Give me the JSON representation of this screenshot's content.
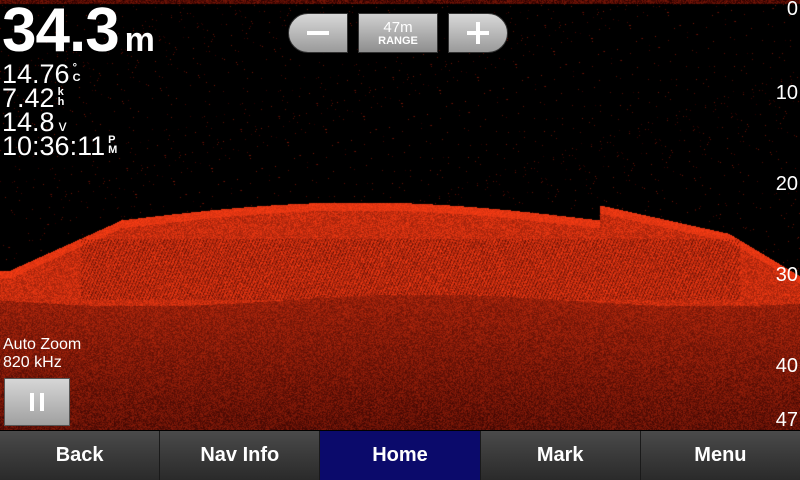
{
  "readouts": {
    "depth": "34.3",
    "depth_unit": "m",
    "temperature": "14.76",
    "temperature_unit_top": "°",
    "temperature_unit_bottom": "C",
    "speed": "7.42",
    "speed_unit_top": "k",
    "speed_unit_bottom": "h",
    "voltage": "14.8",
    "voltage_unit": "v",
    "time": "10:36:11",
    "time_unit_top": "P",
    "time_unit_bottom": "M"
  },
  "range": {
    "value": "47m",
    "caption": "RANGE"
  },
  "depth_scale": [
    "0",
    "10",
    "20",
    "30",
    "40",
    "47"
  ],
  "mode": {
    "zoom": "Auto Zoom",
    "frequency": "820 kHz"
  },
  "softkeys": [
    {
      "label": "Back"
    },
    {
      "label": "Nav Info"
    },
    {
      "label": "Home",
      "active": true
    },
    {
      "label": "Mark"
    },
    {
      "label": "Menu"
    }
  ],
  "colors": {
    "sonar_return": "#d83a10",
    "sonar_bright": "#ff5a1e",
    "active_softkey": "#0b0a6b"
  }
}
